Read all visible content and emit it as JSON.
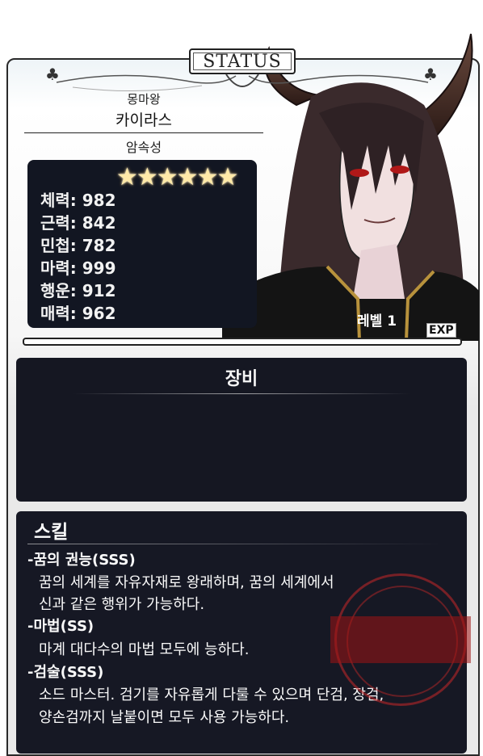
{
  "header": {
    "tab_label": "STATUS"
  },
  "character": {
    "subtitle": "몽마왕",
    "name": "카이라스",
    "attribute": "암속성",
    "stars": "★★★★★★",
    "level": "레벨 1",
    "exp_label": "EXP",
    "exp_progress": 0.0
  },
  "stats": [
    {
      "label": "체력: 982"
    },
    {
      "label": "근력: 842"
    },
    {
      "label": "민첩: 782"
    },
    {
      "label": "마력: 999"
    },
    {
      "label": "행운: 912"
    },
    {
      "label": "매력: 962"
    }
  ],
  "equipment": {
    "title": "장비"
  },
  "skills": {
    "title": "스킬",
    "lines": [
      {
        "kind": "name",
        "text": "-꿈의 권능(SSS)"
      },
      {
        "kind": "desc",
        "text": "꿈의 세계를 자유자재로 왕래하며, 꿈의 세계에서"
      },
      {
        "kind": "desc",
        "text": "신과 같은 행위가 가능하다."
      },
      {
        "kind": "name",
        "text": "-마법(SS)"
      },
      {
        "kind": "desc",
        "text": "마계 대다수의 마법 모두에 능하다."
      },
      {
        "kind": "name",
        "text": "-검술(SSS)"
      },
      {
        "kind": "desc",
        "text": "소드 마스터. 검기를 자유롭게 다룰 수 있으며 단검, 장검,"
      },
      {
        "kind": "desc",
        "text": "양손검까지 날붙이면 모두 사용 가능하다."
      }
    ]
  },
  "colors": {
    "panel": "#151722",
    "star": "#ffe9a8",
    "frame": "#2a2a2a"
  }
}
